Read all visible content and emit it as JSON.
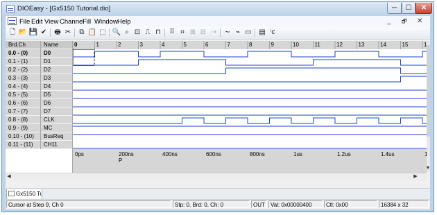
{
  "window": {
    "title": "DIOEasy - [Gx5150 Tutorial.dio]"
  },
  "caption_buttons": {
    "minimize": "─",
    "maximize": "☐",
    "close": "✕"
  },
  "menu": {
    "items": [
      {
        "label": "File"
      },
      {
        "label": "Edit"
      },
      {
        "label": "View"
      },
      {
        "label": "Channel"
      },
      {
        "label": "Fill"
      },
      {
        "label": "Window"
      },
      {
        "label": "Help"
      }
    ],
    "mdi_controls": {
      "minimize": "_",
      "restore": "🗗",
      "close": "✕"
    }
  },
  "toolbar": {
    "buttons": [
      {
        "name": "new-icon",
        "glyph": "🗋",
        "enabled": true
      },
      {
        "name": "open-icon",
        "glyph": "📂",
        "enabled": true
      },
      {
        "name": "save-icon",
        "glyph": "💾",
        "enabled": true
      },
      {
        "name": "check-icon",
        "glyph": "✔",
        "enabled": true
      },
      {
        "name": "print-icon",
        "glyph": "🖶",
        "enabled": true
      },
      {
        "name": "cut-icon",
        "glyph": "✂",
        "enabled": true
      },
      {
        "name": "copy-icon",
        "glyph": "⧉",
        "enabled": true
      },
      {
        "name": "paste-icon",
        "glyph": "📋",
        "enabled": false
      },
      {
        "name": "select-icon",
        "glyph": "⬚",
        "enabled": true
      },
      {
        "name": "zoom-in-icon",
        "glyph": "🔍",
        "enabled": true
      },
      {
        "name": "zoom-out-icon",
        "glyph": "⌕",
        "enabled": true
      },
      {
        "name": "zoom-fit-icon",
        "glyph": "⊡",
        "enabled": true
      },
      {
        "name": "wave-pulse-icon",
        "glyph": "⎍",
        "enabled": true
      },
      {
        "name": "clock-wave-icon",
        "glyph": "⊓",
        "enabled": true
      },
      {
        "name": "binary-count-icon",
        "glyph": "⠿",
        "enabled": true
      },
      {
        "name": "grid-dots-icon",
        "glyph": "⠶",
        "enabled": true
      },
      {
        "name": "fill-rows-icon",
        "glyph": "⊞",
        "enabled": false
      },
      {
        "name": "fill-cols-icon",
        "glyph": "⊟",
        "enabled": false
      },
      {
        "name": "shift-wave-icon",
        "glyph": "⇢",
        "enabled": false
      },
      {
        "name": "line-high-icon",
        "glyph": "∼",
        "enabled": true
      },
      {
        "name": "line-low-icon",
        "glyph": "⌁",
        "enabled": true
      },
      {
        "name": "bus-icon",
        "glyph": "▭",
        "enabled": true
      },
      {
        "name": "channel-settings-icon",
        "glyph": "▤",
        "enabled": true
      },
      {
        "name": "compile-icon",
        "glyph": "ⁱc",
        "enabled": true
      }
    ]
  },
  "grid": {
    "headers": {
      "brd_ch": "Brd.Ch",
      "name": "Name"
    },
    "step_ticks": [
      "0",
      "1",
      "2",
      "3",
      "4",
      "5",
      "6",
      "7",
      "8",
      "9",
      "10",
      "11",
      "12",
      "13",
      "14",
      "15",
      "1"
    ],
    "rows": [
      {
        "brd": "0.0 - (0)",
        "name": "D0",
        "wave": [
          0,
          1,
          1,
          0,
          1,
          1,
          0,
          0,
          1,
          1,
          0,
          0,
          1,
          1,
          0,
          0,
          1
        ],
        "bold": true
      },
      {
        "brd": "0.1 - (1)",
        "name": "D1",
        "wave": [
          0,
          0,
          0,
          1,
          1,
          1,
          1,
          0,
          0,
          0,
          0,
          1,
          1,
          1,
          1,
          0,
          0
        ]
      },
      {
        "brd": "0.2 - (2)",
        "name": "D2",
        "wave": [
          0,
          0,
          0,
          0,
          0,
          0,
          0,
          1,
          1,
          1,
          1,
          1,
          1,
          1,
          1,
          0,
          0
        ]
      },
      {
        "brd": "0.3 - (3)",
        "name": "D3",
        "wave": [
          0,
          0,
          0,
          0,
          0,
          0,
          0,
          0,
          0,
          0,
          0,
          0,
          0,
          0,
          0,
          1,
          1
        ]
      },
      {
        "brd": "0.4 - (4)",
        "name": "D4",
        "wave": [
          0,
          0,
          0,
          0,
          0,
          0,
          0,
          0,
          0,
          0,
          0,
          0,
          0,
          0,
          0,
          0,
          0
        ]
      },
      {
        "brd": "0.5 - (5)",
        "name": "D5",
        "wave": [
          0,
          0,
          0,
          0,
          0,
          0,
          0,
          0,
          0,
          0,
          0,
          0,
          0,
          0,
          0,
          0,
          0
        ]
      },
      {
        "brd": "0.6 - (6)",
        "name": "D6",
        "wave": [
          0,
          0,
          0,
          0,
          0,
          0,
          0,
          0,
          0,
          0,
          0,
          0,
          0,
          0,
          0,
          0,
          0
        ]
      },
      {
        "brd": "0.7 - (7)",
        "name": "D7",
        "wave": [
          0,
          0,
          0,
          0,
          0,
          0,
          0,
          0,
          0,
          0,
          0,
          0,
          0,
          0,
          0,
          0,
          0
        ]
      },
      {
        "brd": "0.8 - (8)",
        "name": "CLK",
        "wave": [
          0,
          0,
          0,
          0,
          0,
          1,
          0,
          1,
          0,
          1,
          0,
          1,
          0,
          1,
          0,
          1,
          0
        ]
      },
      {
        "brd": "0.9 - (9)",
        "name": "MC",
        "wave": [
          1,
          1,
          1,
          1,
          1,
          1,
          1,
          1,
          1,
          1,
          1,
          1,
          1,
          1,
          1,
          1,
          1
        ]
      },
      {
        "brd": "0.10 - (10)",
        "name": "BusReq",
        "wave": [
          1,
          1,
          1,
          1,
          1,
          1,
          1,
          1,
          1,
          1,
          1,
          1,
          1,
          1,
          1,
          1,
          1
        ]
      },
      {
        "brd": "0.11 - (11)",
        "name": "CH11",
        "wave": [
          0,
          0,
          0,
          0,
          0,
          0,
          0,
          0,
          0,
          0,
          0,
          0,
          0,
          0,
          0,
          0,
          0
        ]
      }
    ],
    "time_labels": [
      {
        "step": 0,
        "text": "0ps",
        "sub": ""
      },
      {
        "step": 2,
        "text": "200ns",
        "sub": "P"
      },
      {
        "step": 4,
        "text": "400ns",
        "sub": ""
      },
      {
        "step": 6,
        "text": "600ns",
        "sub": ""
      },
      {
        "step": 8,
        "text": "800ns",
        "sub": ""
      },
      {
        "step": 10,
        "text": "1us",
        "sub": ""
      },
      {
        "step": 12,
        "text": "1.2us",
        "sub": ""
      },
      {
        "step": 14,
        "text": "1.4us",
        "sub": ""
      },
      {
        "step": 16,
        "text": "1",
        "sub": ""
      }
    ],
    "cursor": {
      "step": 0,
      "row": 0
    }
  },
  "scroll": {
    "left_arrow": "◀",
    "right_arrow": "▶",
    "up_arrow": "▲",
    "down_arrow": "▼"
  },
  "tabs": [
    {
      "label": "Gx5150 Tut..."
    }
  ],
  "status": {
    "cursor": "Cursor at Step 9, Ch 0",
    "location": "Stp: 0, Brd: 0, Ch: 0",
    "mode": "OUT",
    "value": "Val: 0x00000400",
    "ctl": "Ctl: 0x00",
    "size": "16384 x 32"
  },
  "colors": {
    "wave": "#1b3fd6",
    "cursor": "#000000"
  }
}
